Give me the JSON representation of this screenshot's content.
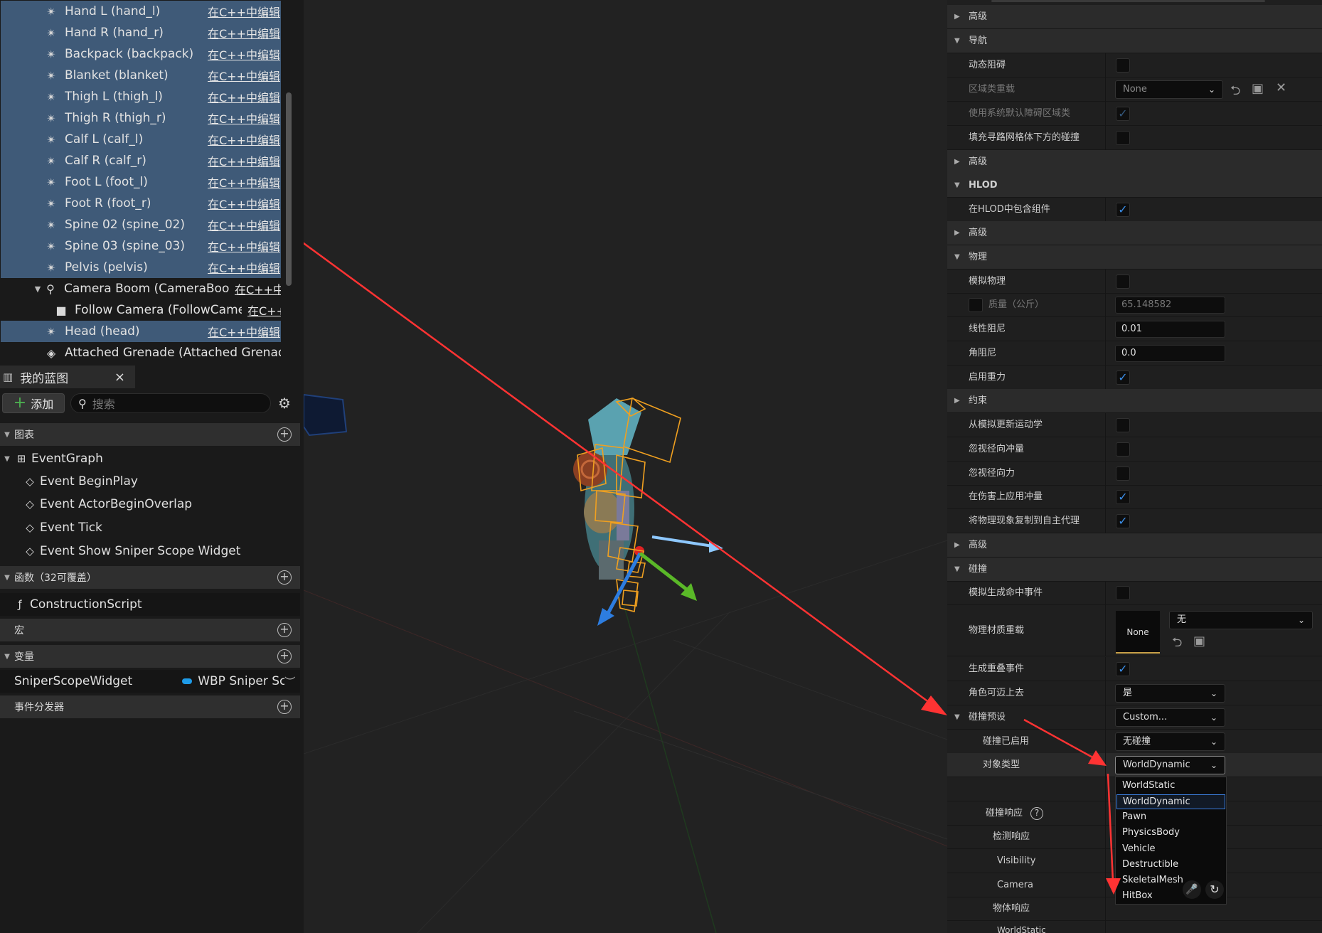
{
  "components": [
    {
      "name": "Hand L (hand_l)",
      "edit": "在C++中编辑",
      "selected": true
    },
    {
      "name": "Hand R (hand_r)",
      "edit": "在C++中编辑",
      "selected": true
    },
    {
      "name": "Backpack (backpack)",
      "edit": "在C++中编辑",
      "selected": true
    },
    {
      "name": "Blanket (blanket)",
      "edit": "在C++中编辑",
      "selected": true
    },
    {
      "name": "Thigh L (thigh_l)",
      "edit": "在C++中编辑",
      "selected": true
    },
    {
      "name": "Thigh R (thigh_r)",
      "edit": "在C++中编辑",
      "selected": true
    },
    {
      "name": "Calf L (calf_l)",
      "edit": "在C++中编辑",
      "selected": true
    },
    {
      "name": "Calf R (calf_r)",
      "edit": "在C++中编辑",
      "selected": true
    },
    {
      "name": "Foot L (foot_l)",
      "edit": "在C++中编辑",
      "selected": true
    },
    {
      "name": "Foot R (foot_r)",
      "edit": "在C++中编辑",
      "selected": true
    },
    {
      "name": "Spine 02 (spine_02)",
      "edit": "在C++中编辑",
      "selected": true
    },
    {
      "name": "Spine 03 (spine_03)",
      "edit": "在C++中编辑",
      "selected": true
    },
    {
      "name": "Pelvis (pelvis)",
      "edit": "在C++中编辑",
      "selected": true
    },
    {
      "name": "Camera Boom (CameraBoom)",
      "edit": "在C++中",
      "selected": false
    },
    {
      "name": "Follow Camera (FollowCamera)",
      "edit": "在C++",
      "selected": false
    },
    {
      "name": "Head (head)",
      "edit": "在C++中编辑",
      "selected": true
    },
    {
      "name": "Attached Grenade (Attached Grenade)",
      "edit": "",
      "selected": false
    }
  ],
  "my_blueprint": {
    "tab_title": "我的蓝图",
    "close": "×",
    "add_label": "添加",
    "search_placeholder": "搜索",
    "graphs_title": "图表",
    "event_graph": "EventGraph",
    "events": [
      "Event BeginPlay",
      "Event ActorBeginOverlap",
      "Event Tick",
      "Event Show Sniper Scope Widget"
    ],
    "functions_title": "函数（32可覆盖）",
    "construction_script": "ConstructionScript",
    "macros_title": "宏",
    "variables_title": "变量",
    "variable_name": "SniperScopeWidget",
    "variable_type": "WBP Sniper Scc",
    "dispatchers_title": "事件分发器"
  },
  "details": {
    "advanced": "高级",
    "navigation": "导航",
    "dynamic_obstacle": "动态阻碍",
    "area_class_override": "区域类重载",
    "area_class_value": "None",
    "use_system_default": "使用系统默认障碍区域类",
    "fill_collision": "填充寻路网格体下方的碰撞",
    "hlod": "HLOD",
    "include_in_hlod": "在HLOD中包含组件",
    "physics": "物理",
    "simulate_physics": "模拟物理",
    "mass": "质量（公斤）",
    "mass_value": "65.148582",
    "linear_damping": "线性阻尼",
    "linear_damping_value": "0.01",
    "angular_damping": "角阻尼",
    "angular_damping_value": "0.0",
    "enable_gravity": "启用重力",
    "constraints": "约束",
    "update_kinematic": "从模拟更新运动学",
    "ignore_radial_impulse": "忽视径向冲量",
    "ignore_radial_force": "忽视径向力",
    "apply_impulse_on_damage": "在伤害上应用冲量",
    "replicate_physics": "将物理现象复制到自主代理",
    "collision": "碰撞",
    "sim_hit_events": "模拟生成命中事件",
    "phys_material_override": "物理材质重载",
    "phys_material_thumb": "None",
    "phys_material_value": "无",
    "gen_overlap_events": "生成重叠事件",
    "can_step_up": "角色可迈上去",
    "can_step_up_value": "是",
    "collision_presets": "碰撞预设",
    "collision_presets_value": "Custom...",
    "collision_enabled": "碰撞已启用",
    "collision_enabled_value": "无碰撞",
    "object_type": "对象类型",
    "object_type_value": "WorldDynamic",
    "collision_responses": "碰撞响应",
    "help": "?",
    "trace_responses": "检测响应",
    "visibility": "Visibility",
    "camera": "Camera",
    "object_responses": "物体响应",
    "world_static": "WorldStatic"
  },
  "object_type_options": [
    "WorldStatic",
    "WorldDynamic",
    "Pawn",
    "PhysicsBody",
    "Vehicle",
    "Destructible",
    "SkeletalMesh",
    "HitBox"
  ],
  "object_type_selected": "WorldDynamic",
  "colors": {
    "selection": "#3f5a78",
    "accent": "#3b8fea",
    "annotation": "#ff3333",
    "character_bounds": "#f0a020"
  }
}
